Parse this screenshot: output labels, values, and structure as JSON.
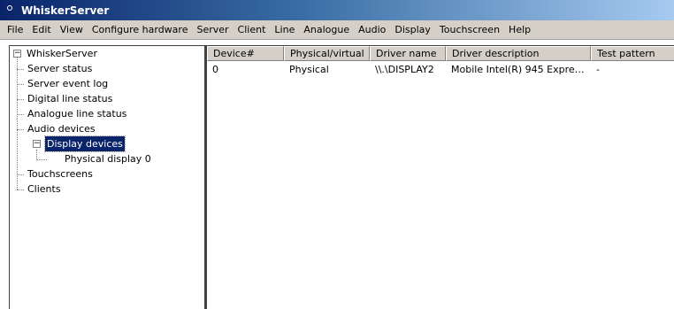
{
  "window": {
    "title": "WhiskerServer"
  },
  "menu": [
    "File",
    "Edit",
    "View",
    "Configure hardware",
    "Server",
    "Client",
    "Line",
    "Analogue",
    "Audio",
    "Display",
    "Touchscreen",
    "Help"
  ],
  "tree": {
    "root": "WhiskerServer",
    "items": [
      "Server status",
      "Server event log",
      "Digital line status",
      "Analogue line status",
      "Audio devices",
      "Display devices",
      "Touchscreens",
      "Clients"
    ],
    "display_children": [
      "Physical display 0"
    ],
    "selected": "Display devices"
  },
  "table": {
    "columns": [
      "Device#",
      "Physical/virtual",
      "Driver name",
      "Driver description",
      "Test pattern"
    ],
    "rows": [
      [
        "0",
        "Physical",
        "\\\\.\\DISPLAY2",
        "Mobile Intel(R) 945 Expre…",
        "-"
      ]
    ]
  },
  "colors": {
    "title_start": "#0a246a",
    "title_end": "#a6caf0",
    "selection": "#0a246a",
    "chrome": "#d4d0c8"
  }
}
